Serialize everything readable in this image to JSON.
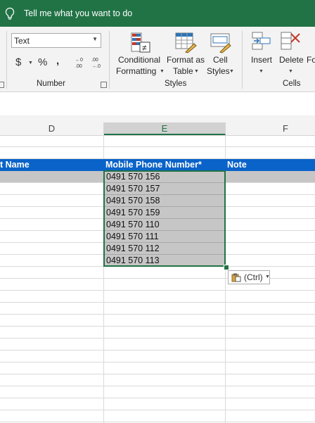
{
  "tell_me": {
    "text": "Tell me what you want to do"
  },
  "ribbon": {
    "number_format_value": "Text",
    "currency_symbol": "$",
    "percent_symbol": "%",
    "comma_symbol": ",",
    "number_group_label": "Number",
    "styles_group_label": "Styles",
    "cells_group_label": "Cells",
    "conditional_formatting_line1": "Conditional",
    "conditional_formatting_line2": "Formatting",
    "format_as_table_line1": "Format as",
    "format_as_table_line2": "Table",
    "cell_styles_line1": "Cell",
    "cell_styles_line2": "Styles",
    "insert_label": "Insert",
    "delete_label": "Delete",
    "format_label_partial": "Fo",
    "increase_decimal_glyph": "←0\n.00",
    "decrease_decimal_glyph": ".00\n→.0"
  },
  "columns": {
    "d": "D",
    "e": "E",
    "f": "F"
  },
  "table_header": {
    "last_name_partial": "t Name",
    "mobile": "Mobile Phone Number*",
    "note": "Note"
  },
  "phones": [
    "0491 570 156",
    "0491 570 157",
    "0491 570 158",
    "0491 570 159",
    "0491 570 110",
    "0491 570 111",
    "0491 570 112",
    "0491 570 113"
  ],
  "paste_options": {
    "label": "(Ctrl)"
  },
  "colors": {
    "excel_green": "#217346",
    "header_blue": "#0a63c8",
    "selection_gray": "#c6c6c6"
  }
}
